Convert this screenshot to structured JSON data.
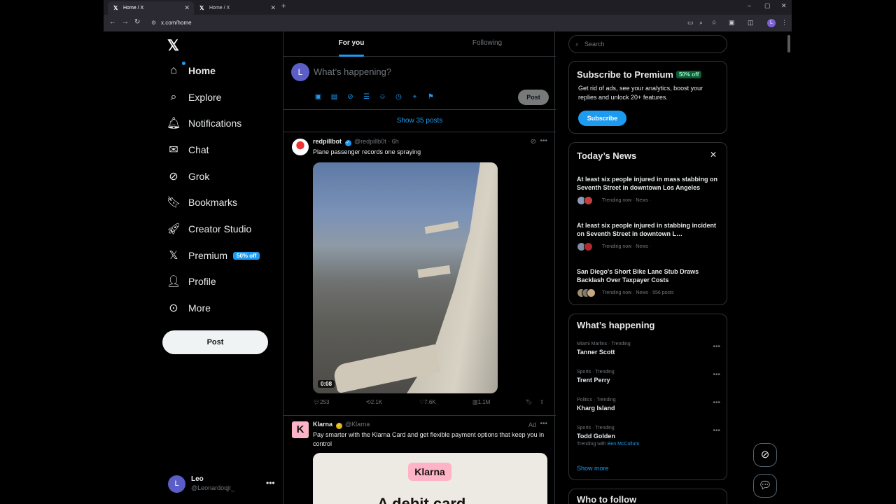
{
  "browser": {
    "tabs": [
      {
        "title": "Home / X"
      },
      {
        "title": "Home / X"
      }
    ],
    "url": "x.com/home"
  },
  "leftnav": {
    "items": [
      {
        "label": "Home",
        "icon": "home-icon"
      },
      {
        "label": "Explore",
        "icon": "search-icon"
      },
      {
        "label": "Notifications",
        "icon": "bell-icon"
      },
      {
        "label": "Chat",
        "icon": "mail-icon"
      },
      {
        "label": "Grok",
        "icon": "grok-icon"
      },
      {
        "label": "Bookmarks",
        "icon": "bookmark-icon"
      },
      {
        "label": "Creator Studio",
        "icon": "rocket-icon"
      },
      {
        "label": "Premium",
        "icon": "x-icon",
        "badge": "50% off"
      },
      {
        "label": "Profile",
        "icon": "person-icon"
      },
      {
        "label": "More",
        "icon": "more-circle-icon"
      }
    ],
    "post_label": "Post",
    "account": {
      "initial": "L",
      "name": "Leo",
      "handle": "@Leonardoqjr_"
    }
  },
  "feed": {
    "tabs": [
      "For you",
      "Following"
    ],
    "composer": {
      "initial": "L",
      "placeholder": "What’s happening?",
      "post_label": "Post"
    },
    "show_posts": "Show 35 posts",
    "tweets": [
      {
        "name": "redpillbot",
        "handle": "@redpillb0t",
        "time": "· 6h",
        "text": "Plane passenger records one spraying",
        "duration": "0:08",
        "replies": "253",
        "reposts": "2.1K",
        "likes": "7.6K",
        "views": "1.1M"
      },
      {
        "name": "Klarna",
        "handle": "@Klarna",
        "ad_label": "Ad",
        "avatar_letter": "K",
        "text": "Pay smarter with the Klarna Card and get flexible payment options that keep you in control",
        "card_logo": "Klarna",
        "card_headline": "A debit card"
      }
    ]
  },
  "right": {
    "search_placeholder": "Search",
    "premium": {
      "title": "Subscribe to Premium",
      "badge": "50% off",
      "description": "Get rid of ads, see your analytics, boost your replies and unlock 20+ features.",
      "button": "Subscribe"
    },
    "news": {
      "title": "Today’s News",
      "items": [
        {
          "headline": "At least six people injured in mass stabbing on Seventh Street in downtown Los Angeles",
          "meta": "Trending now · News ·"
        },
        {
          "headline": "At least six people injured in stabbing incident on Seventh Street in downtown L…",
          "meta": "Trending now · News ·"
        },
        {
          "headline": "San Diego's Short Bike Lane Stub Draws Backlash Over Taxpayer Costs",
          "meta": "Trending now · News · 556 posts"
        }
      ]
    },
    "happening": {
      "title": "What’s happening",
      "trends": [
        {
          "context": "Miami Marlins · Trending",
          "name": "Tanner Scott"
        },
        {
          "context": "Sports · Trending",
          "name": "Trent Perry"
        },
        {
          "context": "Politics · Trending",
          "name": "Kharg Island"
        },
        {
          "context": "Sports · Trending",
          "name": "Todd Golden",
          "with_label": "Trending with",
          "with_name": "Ben McCollum"
        }
      ],
      "show_more": "Show more"
    },
    "who_to_follow": "Who to follow"
  },
  "colors": {
    "accent": "#1d9bf0",
    "background": "#000000",
    "border": "#2f3336",
    "muted": "#71767b"
  }
}
